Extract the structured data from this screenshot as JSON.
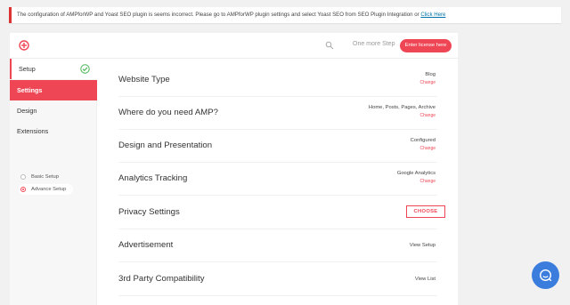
{
  "notice": {
    "text": "The configuration of AMPforWP and Yoast SEO plugin is seems incorrect. Please go to AMPforWP plugin settings and select Yoast SEO from SEO Plugin Integration or ",
    "link": "Click Here"
  },
  "topbar": {
    "one_more_step": "One more Step",
    "license_button": "Enter license here"
  },
  "sidebar": {
    "setup": "Setup",
    "settings": "Settings",
    "design": "Design",
    "extensions": "Extensions",
    "sub_basic": "Basic Setup",
    "sub_advance": "Advance Setup"
  },
  "rows": {
    "website_type": {
      "label": "Website Type",
      "value": "Blog",
      "change": "Change"
    },
    "where_amp": {
      "label": "Where do you need AMP?",
      "value": "Home, Posts, Pages, Archive",
      "change": "Change"
    },
    "design": {
      "label": "Design and Presentation",
      "value": "Configured",
      "change": "Change"
    },
    "analytics": {
      "label": "Analytics Tracking",
      "value": "Google Analytics",
      "change": "Change"
    },
    "privacy": {
      "label": "Privacy Settings",
      "button": "CHOOSE"
    },
    "ads": {
      "label": "Advertisement",
      "link": "View Setup"
    },
    "third_party": {
      "label": "3rd Party Compatibility",
      "link": "View List"
    }
  },
  "colors": {
    "accent": "#ef4655",
    "chat": "#3b7ddd",
    "notice_border": "#dc3232",
    "link": "#0073aa"
  },
  "icons": [
    "logo-icon",
    "search-icon",
    "check-icon",
    "chat-icon"
  ]
}
